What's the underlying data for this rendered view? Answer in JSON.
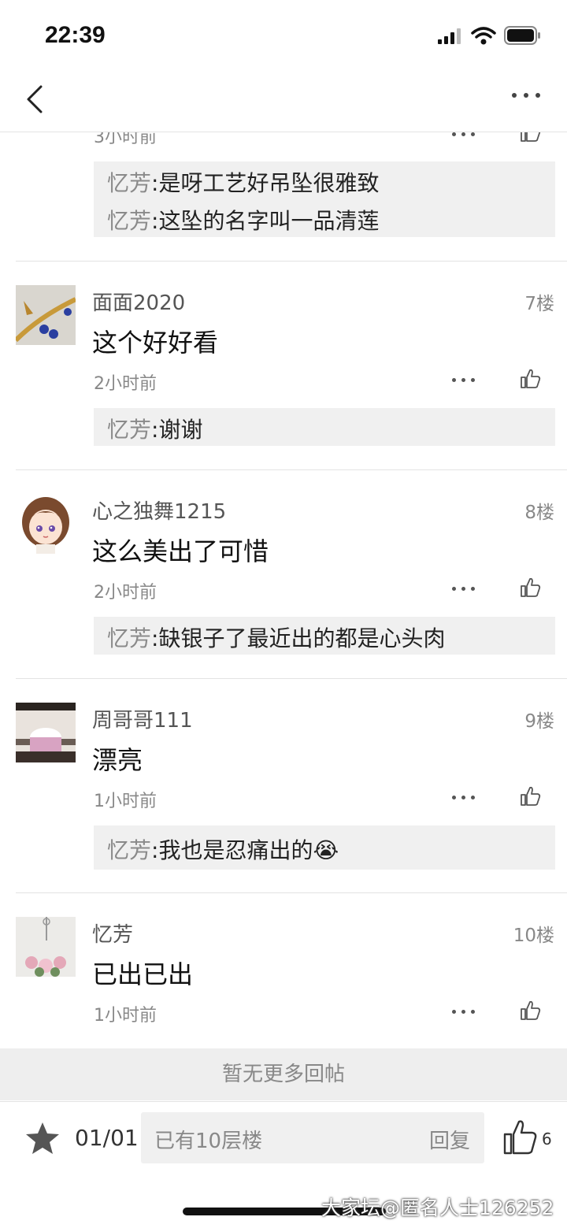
{
  "status": {
    "time": "22:39"
  },
  "partial_prev": {
    "time": "3小时前"
  },
  "prev_quotes": [
    {
      "who": "忆芳",
      "text": ":是呀工艺好吊坠很雅致"
    },
    {
      "who": "忆芳",
      "text": ":这坠的名字叫一品清莲"
    }
  ],
  "comments": [
    {
      "user": "面面2020",
      "floor": "7楼",
      "text": "这个好好看",
      "time": "2小时前",
      "quote": {
        "who": "忆芳",
        "text": ":谢谢"
      }
    },
    {
      "user": "心之独舞1215",
      "floor": "8楼",
      "text": "这么美出了可惜",
      "time": "2小时前",
      "quote": {
        "who": "忆芳",
        "text": ":缺银子了最近出的都是心头肉"
      }
    },
    {
      "user": "周哥哥111",
      "floor": "9楼",
      "text": "漂亮",
      "time": "1小时前",
      "quote": {
        "who": "忆芳",
        "text": ":我也是忍痛出的😭"
      }
    },
    {
      "user": "忆芳",
      "floor": "10楼",
      "text": "已出已出",
      "time": "1小时前"
    }
  ],
  "no_more": "暂无更多回帖",
  "bottom": {
    "page": "01/01",
    "reply_placeholder": "已有10层楼",
    "reply_button": "回复",
    "like_count": "6"
  },
  "watermark": "大家坛@匿名人士126252",
  "icons": {
    "back": "chevron-left-icon",
    "more": "more-icon",
    "like": "thumbs-up-icon",
    "star": "star-icon"
  },
  "colors": {
    "quote_bg": "#f0f0f0",
    "no_more_bg": "#eeeeee"
  }
}
